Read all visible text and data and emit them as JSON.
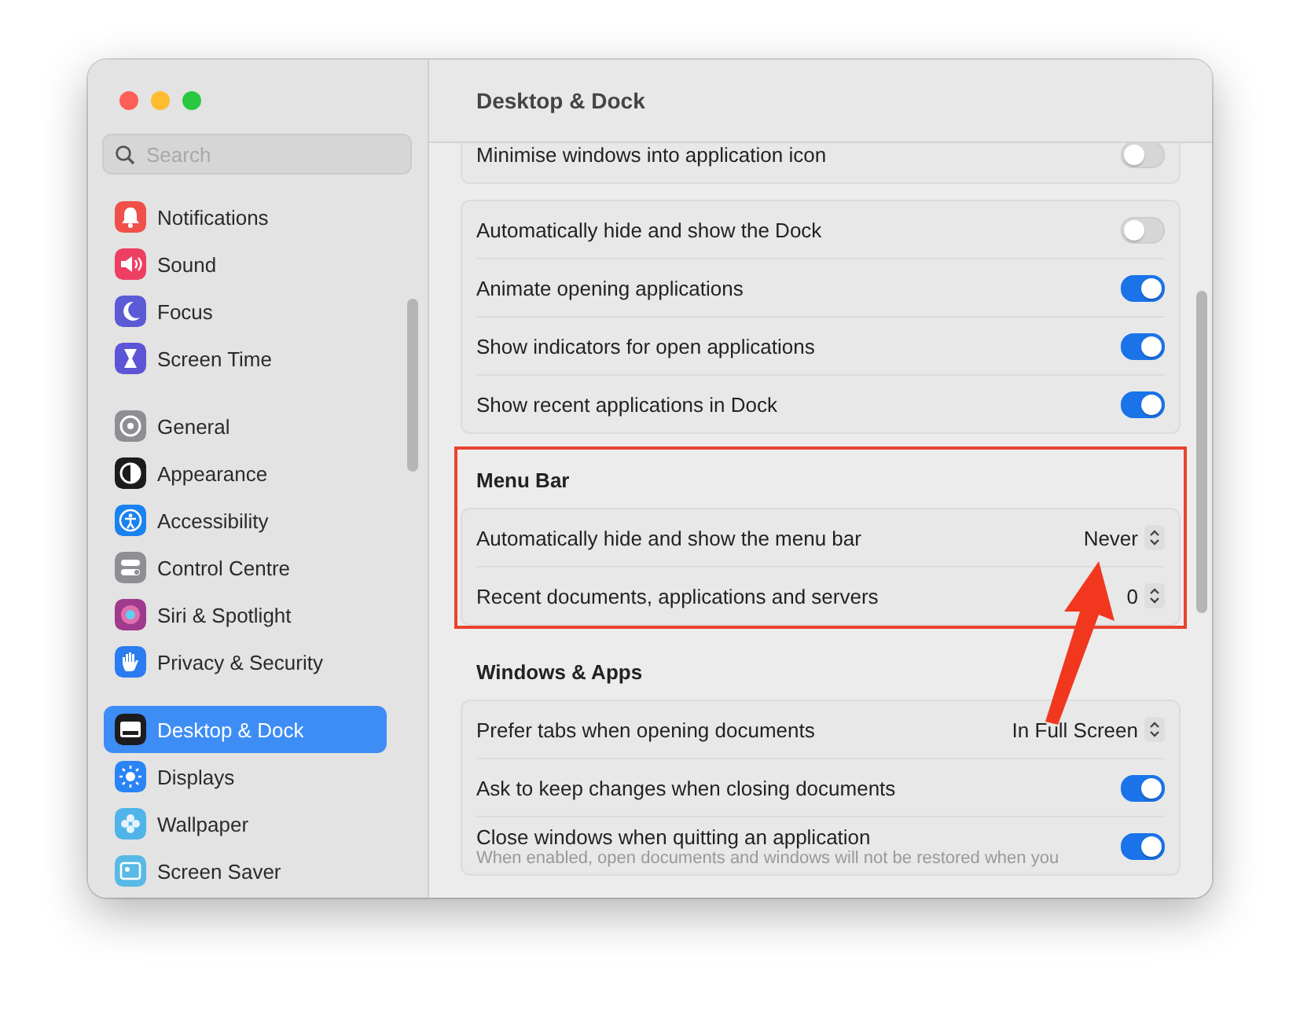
{
  "window": {
    "title": "Desktop & Dock"
  },
  "sidebar": {
    "search": {
      "placeholder": "Search"
    },
    "groups": [
      {
        "items": [
          {
            "label": "Notifications",
            "color": "#f0504a",
            "selected": false
          },
          {
            "label": "Sound",
            "color": "#ee3f63",
            "selected": false
          },
          {
            "label": "Focus",
            "color": "#5b5bd6",
            "selected": false
          },
          {
            "label": "Screen Time",
            "color": "#5d55d6",
            "selected": false
          }
        ]
      },
      {
        "items": [
          {
            "label": "General",
            "color": "#8e8e93",
            "selected": false
          },
          {
            "label": "Appearance",
            "color": "#1c1c1e",
            "selected": false
          },
          {
            "label": "Accessibility",
            "color": "#1a82f0",
            "selected": false
          },
          {
            "label": "Control Centre",
            "color": "#8e8e93",
            "selected": false
          },
          {
            "label": "Siri & Spotlight",
            "color": "#a03a8c",
            "selected": false
          },
          {
            "label": "Privacy & Security",
            "color": "#2a7cf0",
            "selected": false
          }
        ]
      },
      {
        "items": [
          {
            "label": "Desktop & Dock",
            "color": "#1c1c1e",
            "selected": true
          },
          {
            "label": "Displays",
            "color": "#2a84f5",
            "selected": false
          },
          {
            "label": "Wallpaper",
            "color": "#4fb4e8",
            "selected": false
          },
          {
            "label": "Screen Saver",
            "color": "#59b9e6",
            "selected": false
          }
        ]
      }
    ]
  },
  "content": {
    "sections": [
      {
        "rows": [
          {
            "kind": "toggle",
            "label": "Minimise windows into application icon",
            "on": false
          }
        ]
      },
      {
        "rows": [
          {
            "kind": "toggle",
            "label": "Automatically hide and show the Dock",
            "on": false
          },
          {
            "kind": "toggle",
            "label": "Animate opening applications",
            "on": true
          },
          {
            "kind": "toggle",
            "label": "Show indicators for open applications",
            "on": true
          },
          {
            "kind": "toggle",
            "label": "Show recent applications in Dock",
            "on": true
          }
        ]
      },
      {
        "heading": "Menu Bar",
        "highlighted": true,
        "rows": [
          {
            "kind": "popup",
            "label": "Automatically hide and show the menu bar",
            "value": "Never"
          },
          {
            "kind": "popup",
            "label": "Recent documents, applications and servers",
            "value": "0"
          }
        ]
      },
      {
        "heading": "Windows & Apps",
        "rows": [
          {
            "kind": "popup",
            "label": "Prefer tabs when opening documents",
            "value": "In Full Screen"
          },
          {
            "kind": "toggle",
            "label": "Ask to keep changes when closing documents",
            "on": true
          },
          {
            "kind": "toggle",
            "label": "Close windows when quitting an application",
            "on": true,
            "note": "When enabled, open documents and windows will not be restored when you"
          }
        ]
      }
    ]
  }
}
